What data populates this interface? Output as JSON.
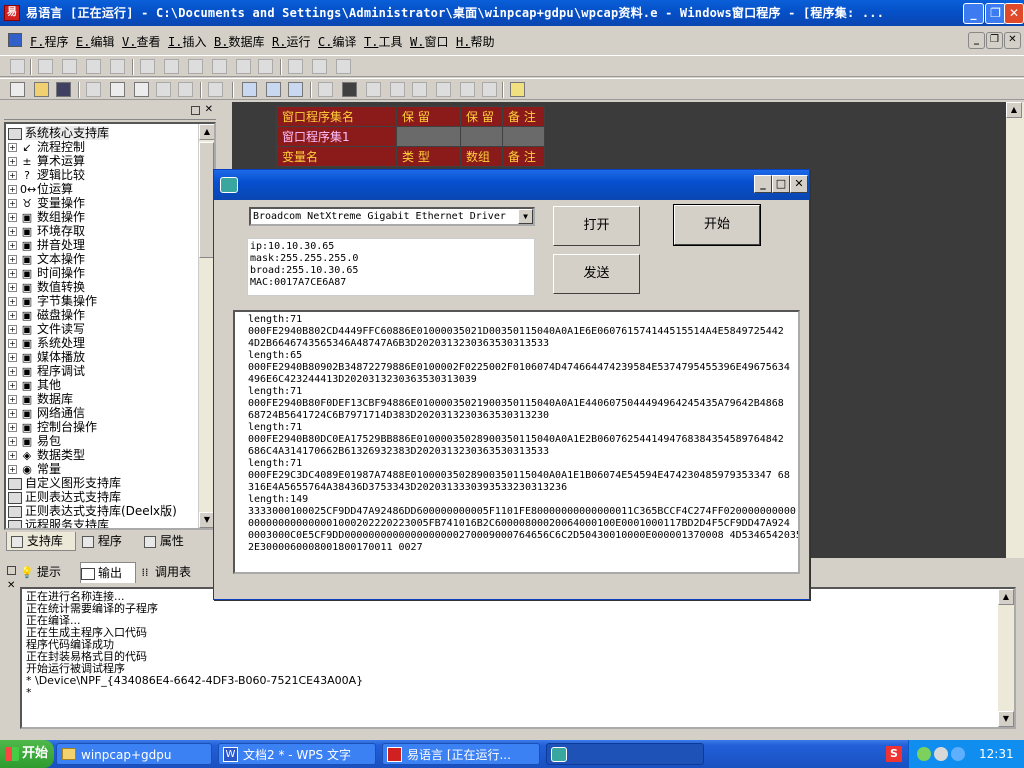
{
  "window": {
    "title": "易语言 [正在运行] - C:\\Documents and Settings\\Administrator\\桌面\\winpcap+gdpu\\wpcap资料.e - Windows窗口程序 - [程序集: ..."
  },
  "menu": [
    {
      "key": "F.",
      "label": "程序"
    },
    {
      "key": "E.",
      "label": "编辑"
    },
    {
      "key": "V.",
      "label": "查看"
    },
    {
      "key": "I.",
      "label": "插入"
    },
    {
      "key": "B.",
      "label": "数据库"
    },
    {
      "key": "R.",
      "label": "运行"
    },
    {
      "key": "C.",
      "label": "编译"
    },
    {
      "key": "T.",
      "label": "工具"
    },
    {
      "key": "W.",
      "label": "窗口"
    },
    {
      "key": "H.",
      "label": "帮助"
    }
  ],
  "tree": {
    "root": "系统核心支持库",
    "items": [
      "流程控制",
      "算术运算",
      "逻辑比较",
      "位运算",
      "变量操作",
      "数组操作",
      "环境存取",
      "拼音处理",
      "文本操作",
      "时间操作",
      "数值转换",
      "字节集操作",
      "磁盘操作",
      "文件读写",
      "系统处理",
      "媒体播放",
      "程序调试",
      "其他",
      "数据库",
      "网络通信",
      "控制台操作",
      "易包",
      "数据类型",
      "常量"
    ],
    "libs": [
      "自定义图形支持库",
      "正则表达式支持库",
      "正则表达式支持库(Deelx版)",
      "远程服务支持库"
    ]
  },
  "left_tabs": [
    "支持库",
    "程序",
    "属性"
  ],
  "code_table": {
    "header1": [
      "窗口程序集名",
      "保 留",
      "保 留",
      "备 注"
    ],
    "row1": "窗口程序集1",
    "header2": [
      "变量名",
      "类 型",
      "数组",
      "备 注"
    ]
  },
  "dialog": {
    "adapter": "Broadcom NetXtreme Gigabit Ethernet Driver",
    "info": "ip:10.10.30.65\nmask:255.255.255.0\nbroad:255.10.30.65\nMAC:0017A7CE6A87",
    "btn_open": "打开",
    "btn_start": "开始",
    "btn_send": "发送",
    "log": "length:71\n000FE2940B802CD4449FFC60886E01000035021D00350115040A0A1E6E060761574144515514A4E5849725442\n4D2B6646743565346A48747A6B3D2020313230363530313533\nlength:65\n000FE2940B80902B34872279886E0100002F0225002F0106074D474664474239584E5374795455396E49675634\n496E6C423244413D2020313230363530313039\nlength:71\n000FE2940B80F0DEF13CBF94886E01000035021900350115040A0A1E4406075044494964245435A79642B4868\n68724B5641724C6B7971714D383D2020313230363530313230\nlength:71\n000FE2940B80DC0EA17529BB886E01000035028900350115040A0A1E2B0607625441494768384354589764842\n686C4A314170662B61326932383D2020313230363530313533\nlength:71\n000FE29C3DC4089E01987A7488E01000035028900350115040A0A1E1B06074E54594E474230485979353347 68\n316E4A5655764A38436D3753343D2020313330393533230313236\nlength:149\n3333000100025CF9DD47A92486DD600000000005F1101FE80000000000000011C365BCCF4C274FF020000000000\n000000000000001000202220223005FB741016B2C60000800020064000100E0001000117BD2D4F5CF9DD47A924\n0003000C0E5CF9DD0000000000000000000270009000764656C6C2D50430010000E000001370008 4D5346542035\n2E3000060008001800170011 0027"
  },
  "bottom_tabs": [
    "提示",
    "输出",
    "调用表"
  ],
  "output": "正在进行名称连接...\n正在统计需要编译的子程序\n正在编译...\n正在生成主程序入口代码\n程序代码编译成功\n正在封装易格式目的代码\n开始运行被调试程序\n* \\Device\\NPF_{434086E4-6642-4DF3-B060-7521CE43A00A}\n*",
  "taskbar": {
    "start": "开始",
    "tasks": [
      "winpcap+gdpu",
      "文档2 * - WPS 文字",
      "易语言 [正在运行..."
    ],
    "clock": "12:31"
  },
  "colors": {
    "title_blue": "#0a5fd8",
    "table_header": "#8b1a1a",
    "table_text": "#ffd23a"
  }
}
